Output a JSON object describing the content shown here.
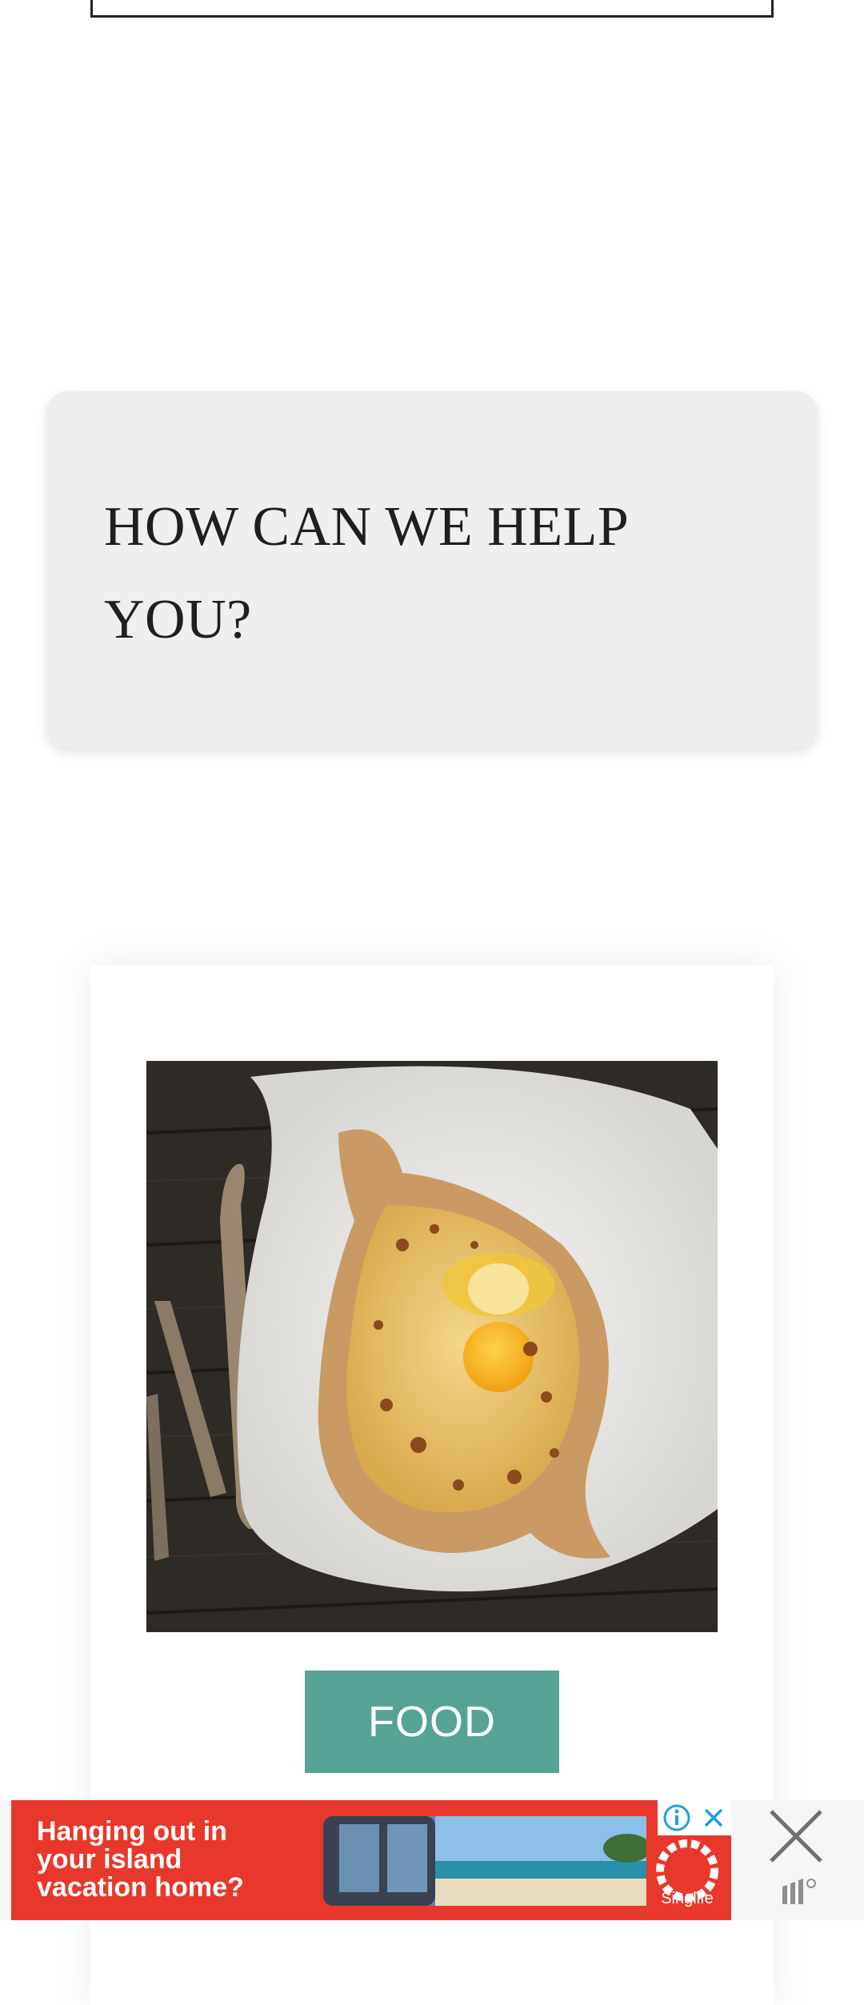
{
  "help_section": {
    "title_line1": "HOW CAN WE HELP",
    "title_line2": "YOU?"
  },
  "post": {
    "image_alt": "Bread boat with cheese, egg and butter on a white plate",
    "category_label": "FOOD"
  },
  "ad": {
    "line1": "Hanging out in",
    "line2": "your island",
    "line3": "vacation home?",
    "brand": "Singlife",
    "info_icon": "info-icon",
    "close_icon": "close-icon",
    "accent": "#e8382b"
  },
  "colors": {
    "category_button": "#55a394",
    "help_card_bg": "#efeff0"
  }
}
